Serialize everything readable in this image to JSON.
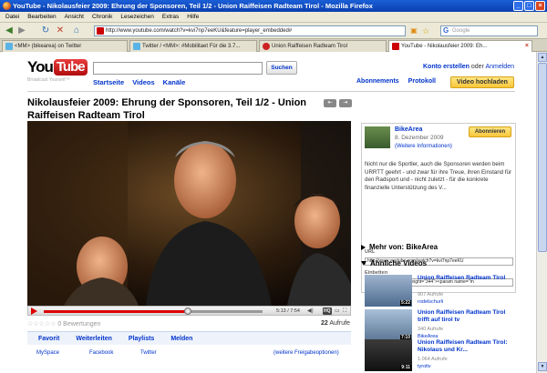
{
  "window": {
    "title": "YouTube - Nikolausfeier 2009: Ehrung der Sponsoren, Teil 1/2 - Union Raiffeisen Radteam Tirol - Mozilla Firefox"
  },
  "menu": [
    "Datei",
    "Bearbeiten",
    "Ansicht",
    "Chronik",
    "Lesezeichen",
    "Extras",
    "Hilfe"
  ],
  "navigation": {
    "url": "http://www.youtube.com/watch?v=kvi7np7eeKU&feature=player_embedded#",
    "search_placeholder": "Google"
  },
  "tabs": [
    {
      "label": "<MM> (bikearea) on Twitter",
      "active": false
    },
    {
      "label": "Twitter / <MM>: #Mobilitaet Für die 3.7...",
      "active": false
    },
    {
      "label": "Union Raiffeisen Radteam Tirol",
      "active": false
    },
    {
      "label": "YouTube - Nikolausfeier 2009: Eh...",
      "active": true
    }
  ],
  "yt_header": {
    "logo_you": "You",
    "logo_tube": "Tube",
    "tagline": "Broadcast Yourself™",
    "search_button": "Suchen",
    "create_account": "Konto erstellen",
    "or": "oder",
    "login": "Anmelden",
    "nav": [
      "Startseite",
      "Videos",
      "Kanäle"
    ],
    "nav_right": [
      "Abonnements",
      "Protokoll"
    ],
    "upload": "Video hochladen"
  },
  "video": {
    "title": "Nikolausfeier 2009: Ehrung der Sponsoren, Teil 1/2 - Union Raiffeisen Radteam Tirol",
    "time": "5:13 / 7:54",
    "progress_fraction": 0.66,
    "rating_text": "0 Bewertungen",
    "views_count": "22",
    "views_label": "Aufrufe",
    "actions": [
      "Favorit",
      "Weiterleiten",
      "Playlists",
      "Melden"
    ],
    "share": [
      "MySpace",
      "Facebook",
      "Twitter",
      "(weitere Freigabeoptionen)"
    ]
  },
  "uploader": {
    "name": "BikeArea",
    "date": "8. Dezember 2009",
    "more_info": "(Weitere Informationen)",
    "subscribe": "Abonnieren",
    "description": "Nicht nur die Sportler, auch die Sponsoren werden beim URRTT geehrt - und zwar für ihre Treue, ihren Einstand für den Radsport und - nicht zuletzt - für die konkrete finanzielle Unterstützung des V...",
    "url_label": "URL",
    "url_value": "http://www.youtube.com/watch?v=kvi7np7eeKU",
    "embed_label": "Einbetten",
    "embed_value": "<object width=\"425\" height=\"344\"><param name=\"m"
  },
  "more_from": "Mehr von: BikeArea",
  "related_header": "Ähnliche Videos",
  "related": [
    {
      "title": "Union Raiffeisen Radteam Tirol",
      "views": "907 Aufrufe",
      "user": "rodelschurli",
      "duration": "5:22"
    },
    {
      "title": "Union Raiffeisen Radteam Tirol trifft auf tirol tv",
      "views": "340 Aufrufe",
      "user": "BikeArea",
      "duration": "7:10"
    },
    {
      "title": "Union Raiffeisen Radteam Tirol: Nikolaus und Kr...",
      "views": "1.064 Aufrufe",
      "user": "tyroltv",
      "duration": "9:11"
    }
  ],
  "colors": {
    "link": "#0033cc",
    "brand_red": "#cc0000",
    "upload_yellow": "#f8c63a",
    "titlebar_blue": "#0a3fb0"
  }
}
